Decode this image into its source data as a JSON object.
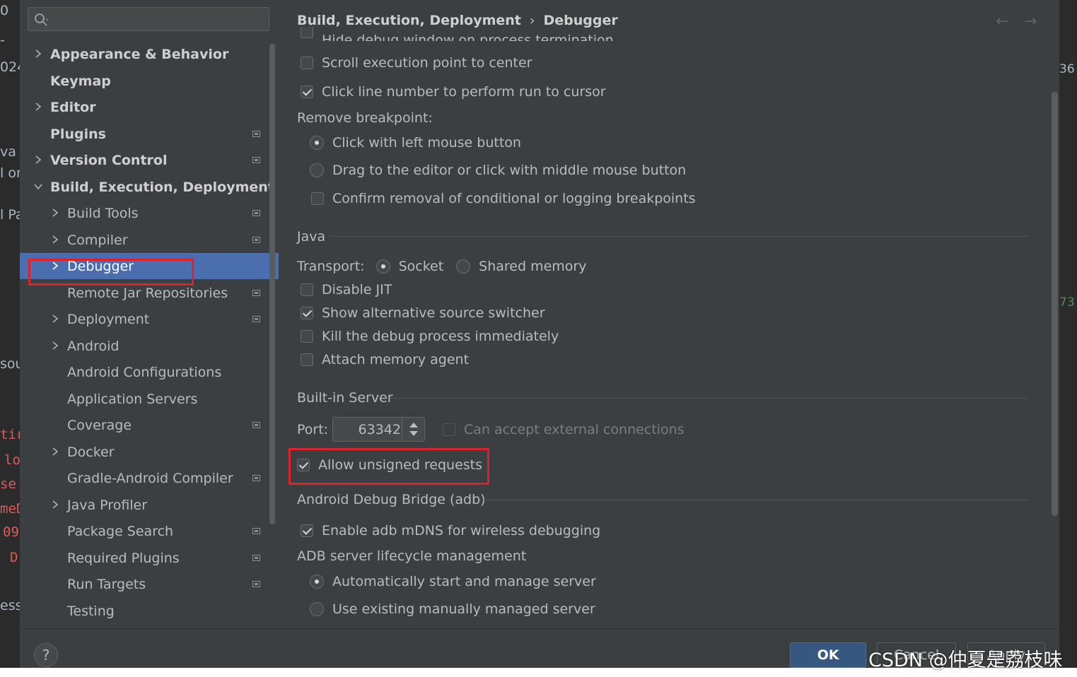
{
  "colors": {
    "selection": "#4b6eaf",
    "highlight_box": "#e2202a",
    "ok_button": "#365880"
  },
  "background_editor": {
    "left_fragments": [
      "0",
      "-",
      "024",
      "va",
      "l or",
      "l Pa",
      "sou",
      "tir",
      "lo",
      "se",
      "meD",
      "09",
      "D",
      "ess"
    ],
    "right_fragments": [
      "36",
      "73"
    ]
  },
  "search": {
    "placeholder": "",
    "icon": "search-icon"
  },
  "tree": {
    "items": [
      {
        "label": "Appearance & Behavior",
        "level": 0,
        "expandable": true,
        "expanded": false,
        "bold": true,
        "project": false
      },
      {
        "label": "Keymap",
        "level": 0,
        "expandable": false,
        "bold": true,
        "project": false
      },
      {
        "label": "Editor",
        "level": 0,
        "expandable": true,
        "expanded": false,
        "bold": true,
        "project": false
      },
      {
        "label": "Plugins",
        "level": 0,
        "expandable": false,
        "bold": true,
        "project": true
      },
      {
        "label": "Version Control",
        "level": 0,
        "expandable": true,
        "expanded": false,
        "bold": true,
        "project": true
      },
      {
        "label": "Build, Execution, Deployment",
        "level": 0,
        "expandable": true,
        "expanded": true,
        "bold": true,
        "project": false
      },
      {
        "label": "Build Tools",
        "level": 1,
        "expandable": true,
        "expanded": false,
        "project": true
      },
      {
        "label": "Compiler",
        "level": 1,
        "expandable": true,
        "expanded": false,
        "project": true
      },
      {
        "label": "Debugger",
        "level": 1,
        "expandable": true,
        "expanded": false,
        "selected": true,
        "project": false
      },
      {
        "label": "Remote Jar Repositories",
        "level": 1,
        "expandable": false,
        "project": true
      },
      {
        "label": "Deployment",
        "level": 1,
        "expandable": true,
        "expanded": false,
        "project": true
      },
      {
        "label": "Android",
        "level": 1,
        "expandable": true,
        "expanded": false,
        "project": false
      },
      {
        "label": "Android Configurations",
        "level": 1,
        "expandable": false,
        "project": false
      },
      {
        "label": "Application Servers",
        "level": 1,
        "expandable": false,
        "project": false
      },
      {
        "label": "Coverage",
        "level": 1,
        "expandable": false,
        "project": true
      },
      {
        "label": "Docker",
        "level": 1,
        "expandable": true,
        "expanded": false,
        "project": false
      },
      {
        "label": "Gradle-Android Compiler",
        "level": 1,
        "expandable": false,
        "project": true
      },
      {
        "label": "Java Profiler",
        "level": 1,
        "expandable": true,
        "expanded": false,
        "project": false
      },
      {
        "label": "Package Search",
        "level": 1,
        "expandable": false,
        "project": true
      },
      {
        "label": "Required Plugins",
        "level": 1,
        "expandable": false,
        "project": true
      },
      {
        "label": "Run Targets",
        "level": 1,
        "expandable": false,
        "project": true
      },
      {
        "label": "Testing",
        "level": 1,
        "expandable": false,
        "project": false
      }
    ]
  },
  "breadcrumb": {
    "parent": "Build, Execution, Deployment",
    "separator": "›",
    "current": "Debugger"
  },
  "nav": {
    "back": "←",
    "forward": "→"
  },
  "settings": {
    "cut_off_top": "Hide debug window on process termination",
    "scroll_exec_point": {
      "label": "Scroll execution point to center",
      "checked": false
    },
    "click_line_number": {
      "label": "Click line number to perform run to cursor",
      "checked": true
    },
    "remove_breakpoint": {
      "title": "Remove breakpoint:",
      "options": [
        {
          "label": "Click with left mouse button",
          "checked": true
        },
        {
          "label": "Drag to the editor or click with middle mouse button",
          "checked": false
        }
      ],
      "confirm": {
        "label": "Confirm removal of conditional or logging breakpoints",
        "checked": false
      }
    },
    "java": {
      "title": "Java",
      "transport_label": "Transport:",
      "transport_options": [
        {
          "label": "Socket",
          "checked": true
        },
        {
          "label": "Shared memory",
          "checked": false
        }
      ],
      "checkboxes": [
        {
          "label": "Disable JIT",
          "checked": false
        },
        {
          "label": "Show alternative source switcher",
          "checked": true
        },
        {
          "label": "Kill the debug process immediately",
          "checked": false
        },
        {
          "label": "Attach memory agent",
          "checked": false
        }
      ]
    },
    "builtin_server": {
      "title": "Built-in Server",
      "port_label": "Port:",
      "port_value": "63342",
      "external": {
        "label": "Can accept external connections",
        "checked": false,
        "disabled": true
      },
      "unsigned": {
        "label": "Allow unsigned requests",
        "checked": true
      }
    },
    "adb": {
      "title": "Android Debug Bridge (adb)",
      "mdns": {
        "label": "Enable adb mDNS for wireless debugging",
        "checked": true
      },
      "lifecycle_title": "ADB server lifecycle management",
      "lifecycle_options": [
        {
          "label": "Automatically start and manage server",
          "checked": true
        },
        {
          "label": "Use existing manually managed server",
          "checked": false
        }
      ]
    }
  },
  "footer": {
    "help": "?",
    "ok": "OK",
    "cancel": "Cancel",
    "apply": "Apply",
    "watermark": "CSDN @仲夏是荔枝味"
  }
}
